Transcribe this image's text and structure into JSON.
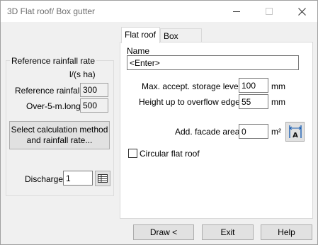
{
  "window": {
    "title": "3D Flat roof/ Box gutter"
  },
  "left": {
    "group_title": "Reference rainfall rate",
    "unit": "l/(s ha)",
    "reference_rainfall_label": "Reference rainfall",
    "reference_rainfall_value": "300",
    "over5_label": "Over-5-m.long",
    "over5_value": "500",
    "select_method_button": "Select calculation method\nand rainfall rate...",
    "discharge_label": "Discharge",
    "discharge_value": "1"
  },
  "tabs": [
    {
      "label": "Flat roof"
    },
    {
      "label": "Box gutter"
    }
  ],
  "flat_roof": {
    "name_label": "Name",
    "name_value": "<Enter>",
    "max_storage_label": "Max. accept. storage level",
    "max_storage_value": "100",
    "max_storage_unit": "mm",
    "overflow_label": "Height up to overflow edge",
    "overflow_value": "55",
    "overflow_unit": "mm",
    "facade_label": "Add. facade area",
    "facade_value": "0",
    "facade_unit": "m²",
    "circular_label": "Circular flat roof",
    "circular_checked": false
  },
  "footer": {
    "draw": "Draw <",
    "exit": "Exit",
    "help": "Help"
  },
  "icons": {
    "close": "close-icon",
    "minimize": "minimize-icon",
    "maximize": "maximize-icon",
    "table": "table-icon",
    "facade": "facade-dimension-icon"
  }
}
